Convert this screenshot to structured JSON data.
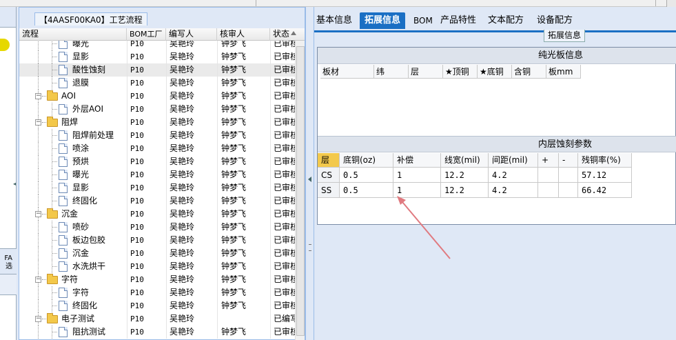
{
  "tree_panel": {
    "title": "【4AASF00KA0】工艺流程",
    "columns": [
      "流程",
      "BOM工厂",
      "编写人",
      "核审人",
      "状态"
    ],
    "rows": [
      {
        "name": "曝光",
        "type": "file",
        "indent": 3,
        "bom": "P10",
        "author": "吴艳玲",
        "reviewer": "钟梦飞",
        "status": "已审核"
      },
      {
        "name": "显影",
        "type": "file",
        "indent": 3,
        "bom": "P10",
        "author": "吴艳玲",
        "reviewer": "钟梦飞",
        "status": "已审核"
      },
      {
        "name": "酸性蚀刻",
        "type": "file",
        "indent": 3,
        "bom": "P10",
        "author": "吴艳玲",
        "reviewer": "钟梦飞",
        "status": "已审核",
        "highlight": true
      },
      {
        "name": "退膜",
        "type": "file",
        "indent": 3,
        "bom": "P10",
        "author": "吴艳玲",
        "reviewer": "钟梦飞",
        "status": "已审核"
      },
      {
        "name": "AOI",
        "type": "folder",
        "indent": 2,
        "bom": "P10",
        "author": "吴艳玲",
        "reviewer": "钟梦飞",
        "status": "已审核"
      },
      {
        "name": "外层AOI",
        "type": "file",
        "indent": 3,
        "bom": "P10",
        "author": "吴艳玲",
        "reviewer": "钟梦飞",
        "status": "已审核"
      },
      {
        "name": "阻焊",
        "type": "folder",
        "indent": 2,
        "bom": "P10",
        "author": "吴艳玲",
        "reviewer": "钟梦飞",
        "status": "已审核"
      },
      {
        "name": "阻焊前处理",
        "type": "file",
        "indent": 3,
        "bom": "P10",
        "author": "吴艳玲",
        "reviewer": "钟梦飞",
        "status": "已审核"
      },
      {
        "name": "喷涂",
        "type": "file",
        "indent": 3,
        "bom": "P10",
        "author": "吴艳玲",
        "reviewer": "钟梦飞",
        "status": "已审核"
      },
      {
        "name": "预烘",
        "type": "file",
        "indent": 3,
        "bom": "P10",
        "author": "吴艳玲",
        "reviewer": "钟梦飞",
        "status": "已审核"
      },
      {
        "name": "曝光",
        "type": "file",
        "indent": 3,
        "bom": "P10",
        "author": "吴艳玲",
        "reviewer": "钟梦飞",
        "status": "已审核"
      },
      {
        "name": "显影",
        "type": "file",
        "indent": 3,
        "bom": "P10",
        "author": "吴艳玲",
        "reviewer": "钟梦飞",
        "status": "已审核"
      },
      {
        "name": "终固化",
        "type": "file",
        "indent": 3,
        "bom": "P10",
        "author": "吴艳玲",
        "reviewer": "钟梦飞",
        "status": "已审核"
      },
      {
        "name": "沉金",
        "type": "folder",
        "indent": 2,
        "bom": "P10",
        "author": "吴艳玲",
        "reviewer": "钟梦飞",
        "status": "已审核"
      },
      {
        "name": "喷砂",
        "type": "file",
        "indent": 3,
        "bom": "P10",
        "author": "吴艳玲",
        "reviewer": "钟梦飞",
        "status": "已审核"
      },
      {
        "name": "板边包胶",
        "type": "file",
        "indent": 3,
        "bom": "P10",
        "author": "吴艳玲",
        "reviewer": "钟梦飞",
        "status": "已审核"
      },
      {
        "name": "沉金",
        "type": "file",
        "indent": 3,
        "bom": "P10",
        "author": "吴艳玲",
        "reviewer": "钟梦飞",
        "status": "已审核"
      },
      {
        "name": "水洗烘干",
        "type": "file",
        "indent": 3,
        "bom": "P10",
        "author": "吴艳玲",
        "reviewer": "钟梦飞",
        "status": "已审核"
      },
      {
        "name": "字符",
        "type": "folder",
        "indent": 2,
        "bom": "P10",
        "author": "吴艳玲",
        "reviewer": "钟梦飞",
        "status": "已审核"
      },
      {
        "name": "字符",
        "type": "file",
        "indent": 3,
        "bom": "P10",
        "author": "吴艳玲",
        "reviewer": "钟梦飞",
        "status": "已审核"
      },
      {
        "name": "终固化",
        "type": "file",
        "indent": 3,
        "bom": "P10",
        "author": "吴艳玲",
        "reviewer": "钟梦飞",
        "status": "已审核"
      },
      {
        "name": "电子测试",
        "type": "folder",
        "indent": 2,
        "bom": "P10",
        "author": "吴艳玲",
        "reviewer": "",
        "status": "已编写"
      },
      {
        "name": "阻抗测试",
        "type": "file",
        "indent": 3,
        "bom": "P10",
        "author": "吴艳玲",
        "reviewer": "钟梦飞",
        "status": "已审核"
      }
    ]
  },
  "left_panel": {
    "bottom_label": "FA\n选"
  },
  "right_panel": {
    "tabs": [
      "基本信息",
      "拓展信息",
      "BOM",
      "产品特性",
      "文本配方",
      "设备配方"
    ],
    "active_tab": 1,
    "sub_caption": "拓展信息",
    "section1": {
      "title": "纯光板信息",
      "columns": [
        "板材",
        "纬",
        "层",
        "★顶铜",
        "★底铜",
        "含铜",
        "板mm"
      ]
    },
    "section2": {
      "title": "内层蚀刻参数",
      "columns": [
        "层",
        "底铜(oz)",
        "补偿",
        "线宽(mil)",
        "间距(mil)",
        "+",
        "-",
        "残铜率(%)"
      ],
      "rows": [
        [
          "CS",
          "0.5",
          "1",
          "12.2",
          "4.2",
          "",
          "",
          "57.12"
        ],
        [
          "SS",
          "0.5",
          "1",
          "12.2",
          "4.2",
          "",
          "",
          "66.42"
        ]
      ]
    },
    "annotation_color": "#e07a80"
  }
}
